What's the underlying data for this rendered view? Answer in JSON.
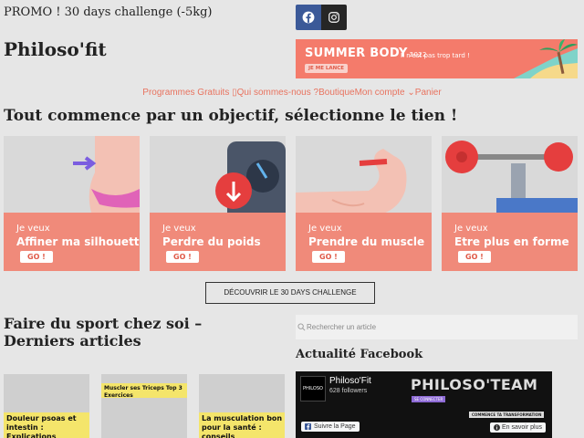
{
  "header": {
    "promo": "PROMO ! 30 days challenge (-5kg)",
    "site_name": "Philoso'fit",
    "social": [
      "facebook-icon",
      "instagram-icon"
    ]
  },
  "banner": {
    "title": "SUMMER BODY",
    "year": "2022",
    "tagline": "Il n'est pas trop tard !",
    "cta": "JE ME LANCE"
  },
  "nav": {
    "items": [
      "Programmes Gratuits",
      "Qui sommes-nous ?",
      "Boutique",
      "Mon compte",
      "Panier"
    ]
  },
  "main": {
    "headline": "Tout commence par un objectif, sélectionne le tien !",
    "goals": [
      {
        "prefix": "Je veux",
        "label": "Affiner ma silhouette",
        "go": "GO !"
      },
      {
        "prefix": "Je veux",
        "label": "Perdre du poids",
        "go": "GO !"
      },
      {
        "prefix": "Je veux",
        "label": "Prendre du muscle",
        "go": "GO !"
      },
      {
        "prefix": "Je veux",
        "label": "Etre plus en forme",
        "go": "GO !"
      }
    ],
    "challenge_button": "DÉCOUVRIR LE 30 DAYS CHALLENGE",
    "articles_heading": "Faire du sport chez soi – Derniers articles",
    "articles": [
      {
        "title": "Douleur psoas et intestin : Explications"
      },
      {
        "title": "Muscler ses Triceps Top 3 Exercices"
      },
      {
        "title": "La musculation bon pour la santé : conseils"
      }
    ]
  },
  "sidebar": {
    "search_placeholder": "Rechercher un article",
    "facebook_heading": "Actualité Facebook",
    "fb_page": {
      "name": "Philoso'Fit",
      "followers": "628 followers",
      "banner_text": "PHILOSO'TEAM",
      "connect": "SE CONNECTER",
      "transform": "COMMENCE TA TRANSFORMATION",
      "follow_label": "Suivre la Page",
      "more_label": "En savoir plus"
    }
  },
  "colors": {
    "accent": "#f08a7a",
    "nav_link": "#e8735f",
    "facebook": "#3b5998"
  }
}
